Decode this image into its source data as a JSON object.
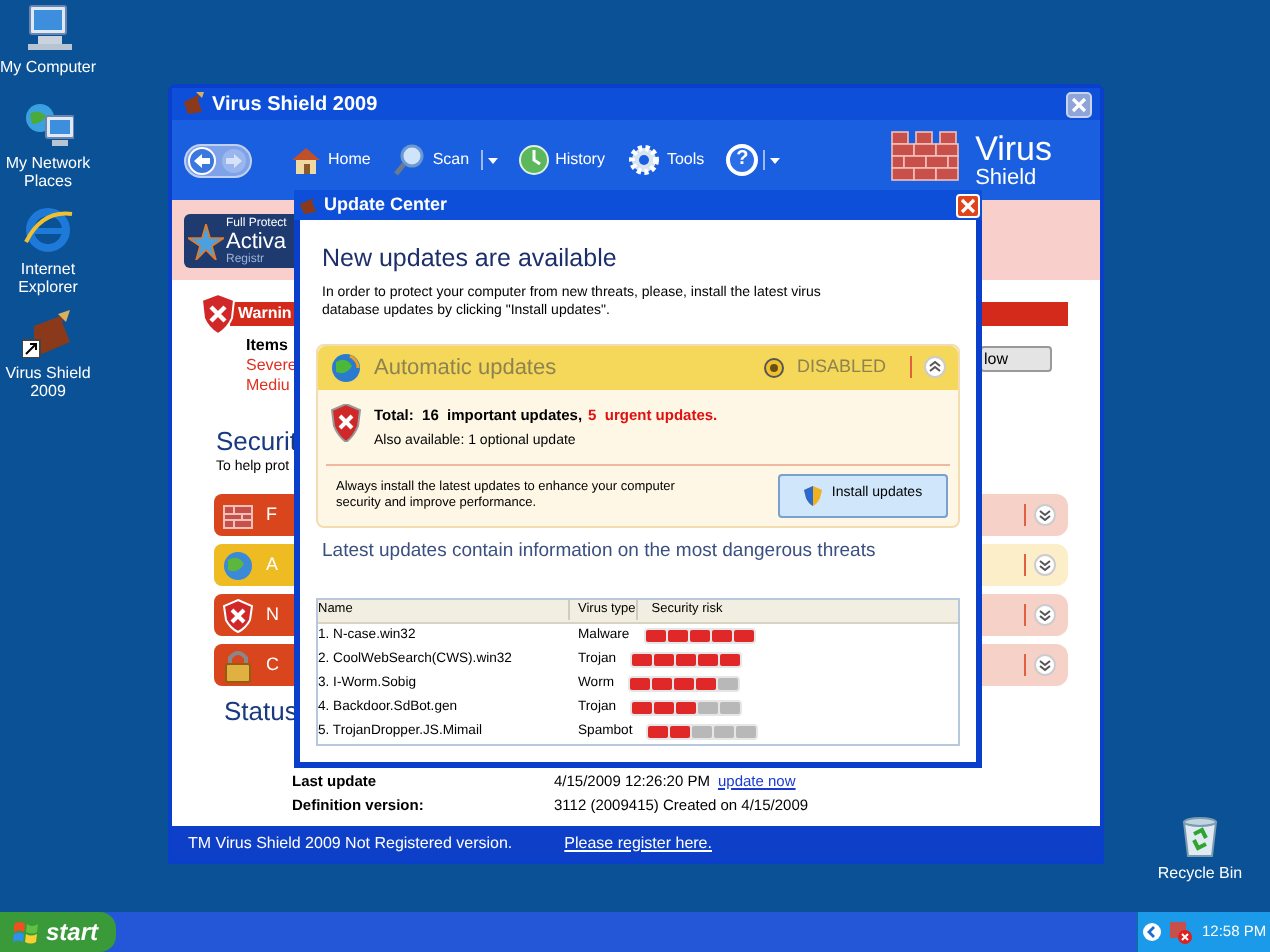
{
  "desktop_icons": [
    {
      "label": "My Computer"
    },
    {
      "label": "My Network Places"
    },
    {
      "label": "Internet Explorer"
    },
    {
      "label": "Virus Shield 2009"
    }
  ],
  "recycle_bin": {
    "label": "Recycle Bin"
  },
  "main_window": {
    "title": "Virus Shield 2009",
    "toolbar": [
      {
        "label": "Home",
        "dropdown": false
      },
      {
        "label": "Scan",
        "dropdown": true
      },
      {
        "label": "History",
        "dropdown": false
      },
      {
        "label": "Tools",
        "dropdown": false
      }
    ],
    "help_button": {
      "label": "?",
      "dropdown": true
    },
    "logo": {
      "line_1": "Virus",
      "line_2": "Shield"
    },
    "banner": {
      "line_1": "Full Protect",
      "line_2": "Activa",
      "line_3": "Registr"
    },
    "warning": {
      "title": "Warnin",
      "items_label": "Items",
      "severe": "Severe",
      "medium": "Mediu",
      "button": "low"
    },
    "security": {
      "heading": "Securit",
      "text": "To help prot"
    },
    "protection_rows": [
      {
        "label": "F",
        "color": "#d9461e"
      },
      {
        "label": "A",
        "color": "#eebb22"
      },
      {
        "label": "N",
        "color": "#d9461e"
      },
      {
        "label": "C",
        "color": "#d9461e"
      }
    ],
    "status": {
      "heading": "Status",
      "last_update_label": "Last update",
      "last_update_value": "4/15/2009 12:26:20 PM",
      "update_link": "update now",
      "definition_label": "Definition version:",
      "definition_value": "3112 (2009415) Created on 4/15/2009"
    },
    "status_bar": {
      "text": "TM Virus Shield 2009 Not Registered version.",
      "link": "Please register here."
    }
  },
  "dialog": {
    "title": "Update Center",
    "heading": "New updates are available",
    "intro": "In order to protect your computer from new threats, please, install the latest virus database updates by clicking \"Install updates\".",
    "panel": {
      "title": "Automatic updates",
      "state": "DISABLED",
      "total": "Total:  16  important updates,",
      "urgent": "5  urgent updates.",
      "optional": "Also available: 1 optional update",
      "advice": "Always install the latest updates to enhance your computer security and improve performance.",
      "button": "Install updates"
    },
    "threats_heading": "Latest updates contain information on the most dangerous threats",
    "table": {
      "columns": [
        "Name",
        "Virus type",
        "Security risk"
      ],
      "rows": [
        {
          "name": "1. N-case.win32",
          "type": "Malware",
          "level": 1
        },
        {
          "name": "2. CoolWebSearch(CWS).win32",
          "type": "Trojan",
          "level": 1
        },
        {
          "name": "3. I-Worm.Sobig",
          "type": "Worm",
          "level": 0.8
        },
        {
          "name": "4. Backdoor.SdBot.gen",
          "type": "Trojan",
          "level": 0.6
        },
        {
          "name": "5. TrojanDropper.JS.Mimail",
          "type": "Spambot",
          "level": 0.4
        }
      ]
    }
  },
  "taskbar": {
    "start": "start",
    "clock": "12:58 PM"
  }
}
